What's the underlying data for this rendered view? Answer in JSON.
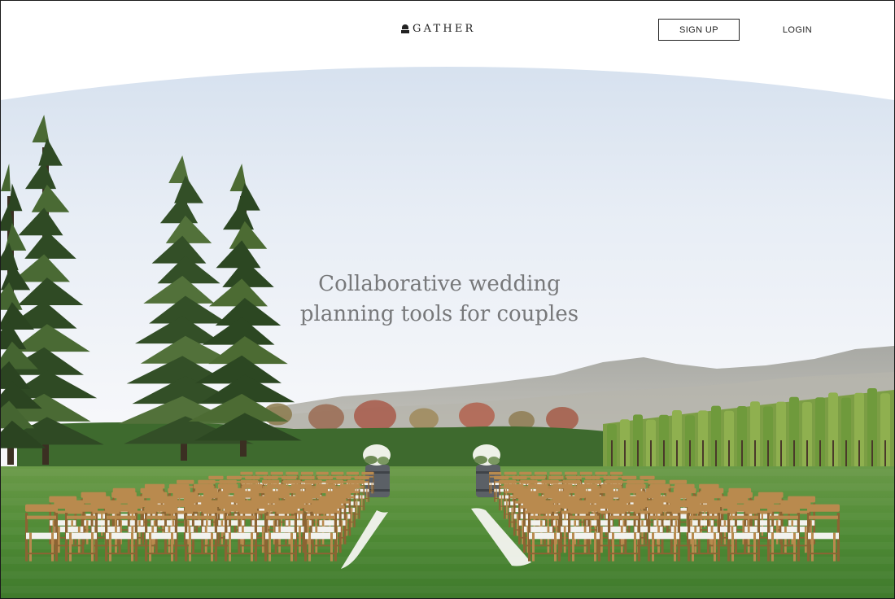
{
  "header": {
    "brand": "GATHER",
    "signup_label": "SIGN UP",
    "login_label": "LOGIN"
  },
  "hero": {
    "headline_line1": "Collaborative wedding",
    "headline_line2": "planning tools for couples",
    "image_alt": "Outdoor wedding ceremony setup with rows of wooden chairs on a lawn, tall pine trees and vineyard hills"
  },
  "colors": {
    "accent": "#222222",
    "headline": "#77787a",
    "sky": "#eef2f8",
    "grass": "#4f8a3a"
  }
}
